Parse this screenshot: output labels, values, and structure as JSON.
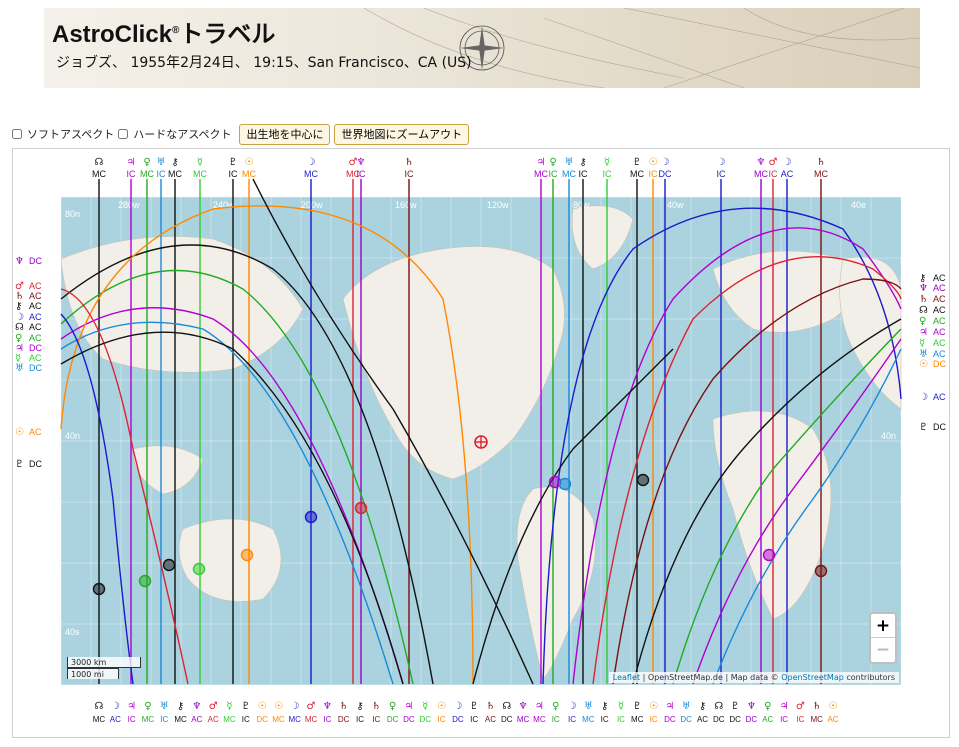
{
  "header": {
    "title": "AstroClick",
    "title_suffix": "トラベル",
    "registered": "®",
    "subtitle": "ジョブズ、 1955年2月24日、 19:15、San Francisco、CA (US)"
  },
  "toolbar": {
    "soft_aspect_label": "ソフトアスペクト",
    "hard_aspect_label": "ハードなアスペクト",
    "center_birthplace_button": "出生地を中心に",
    "zoom_out_world_button": "世界地図にズームアウト"
  },
  "map": {
    "longitude_labels": [
      "280w",
      "240w",
      "200w",
      "160w",
      "120w",
      "80w",
      "40w",
      "40e"
    ],
    "latitude_labels": [
      "80n",
      "40n",
      "40s",
      "40n",
      "40s"
    ],
    "scale": {
      "km": "3000 km",
      "mi": "1000 mi"
    },
    "zoom_in": "+",
    "zoom_out": "−",
    "attribution": {
      "leaflet": "Leaflet",
      "sep": " | OpenStreetMap.de | Map data © ",
      "osm": "OpenStreetMap",
      "tail": " contributors"
    },
    "colors": {
      "ocean": "#aad3df",
      "land": "#f2efe9",
      "grid": "#ffffff"
    }
  },
  "planet_lines": {
    "top": [
      {
        "glyph": "☊",
        "angle": "MC",
        "color": "#111111"
      },
      {
        "glyph": "♃",
        "angle": "IC",
        "color": "#b000d0"
      },
      {
        "glyph": "♀",
        "angle": "MC",
        "color": "#22aa22"
      },
      {
        "glyph": "♅",
        "angle": "IC",
        "color": "#1a8ad8"
      },
      {
        "glyph": "⚷",
        "angle": "MC",
        "color": "#111111"
      },
      {
        "glyph": "☿",
        "angle": "MC",
        "color": "#33cc33"
      },
      {
        "glyph": "♇",
        "angle": "IC",
        "color": "#111111"
      },
      {
        "glyph": "☉",
        "angle": "MC",
        "color": "#ff8800"
      },
      {
        "glyph": "☽",
        "angle": "MC",
        "color": "#1a1acc"
      },
      {
        "glyph": "♂",
        "angle": "MC",
        "color": "#dd2233"
      },
      {
        "glyph": "♆",
        "angle": "IC",
        "color": "#9900cc"
      },
      {
        "glyph": "♄",
        "angle": "IC",
        "color": "#7a1010"
      },
      {
        "glyph": "♃",
        "angle": "MC",
        "color": "#b000d0"
      },
      {
        "glyph": "♀",
        "angle": "IC",
        "color": "#22aa22"
      },
      {
        "glyph": "♅",
        "angle": "MC",
        "color": "#1a8ad8"
      },
      {
        "glyph": "⚷",
        "angle": "IC",
        "color": "#111111"
      },
      {
        "glyph": "☿",
        "angle": "IC",
        "color": "#33cc33"
      },
      {
        "glyph": "♇",
        "angle": "MC",
        "color": "#111111"
      },
      {
        "glyph": "☉",
        "angle": "IC",
        "color": "#ff8800"
      },
      {
        "glyph": "☽",
        "angle": "DC",
        "color": "#1a1acc"
      },
      {
        "glyph": "☽",
        "angle": "IC",
        "color": "#1a1acc"
      },
      {
        "glyph": "♆",
        "angle": "MC",
        "color": "#9900cc"
      },
      {
        "glyph": "♂",
        "angle": "IC",
        "color": "#dd2233"
      },
      {
        "glyph": "☽",
        "angle": "AC",
        "color": "#1a1acc"
      },
      {
        "glyph": "♄",
        "angle": "MC",
        "color": "#7a1010"
      }
    ],
    "left": [
      {
        "glyph": "♆",
        "angle": "DC",
        "color": "#9900cc"
      },
      {
        "glyph": "♂",
        "angle": "AC",
        "color": "#dd2233"
      },
      {
        "glyph": "♄",
        "angle": "AC",
        "color": "#7a1010"
      },
      {
        "glyph": "⚷",
        "angle": "AC",
        "color": "#111111"
      },
      {
        "glyph": "☽",
        "angle": "AC",
        "color": "#1a1acc"
      },
      {
        "glyph": "☊",
        "angle": "AC",
        "color": "#111111"
      },
      {
        "glyph": "♀",
        "angle": "AC",
        "color": "#22aa22"
      },
      {
        "glyph": "♃",
        "angle": "DC",
        "color": "#b000d0"
      },
      {
        "glyph": "☿",
        "angle": "AC",
        "color": "#33cc33"
      },
      {
        "glyph": "♅",
        "angle": "DC",
        "color": "#1a8ad8"
      },
      {
        "glyph": "☉",
        "angle": "AC",
        "color": "#ff8800"
      },
      {
        "glyph": "♇",
        "angle": "DC",
        "color": "#111111"
      }
    ],
    "right": [
      {
        "glyph": "⚷",
        "angle": "AC",
        "color": "#111111"
      },
      {
        "glyph": "♆",
        "angle": "AC",
        "color": "#9900cc"
      },
      {
        "glyph": "♄",
        "angle": "AC",
        "color": "#7a1010"
      },
      {
        "glyph": "☊",
        "angle": "AC",
        "color": "#111111"
      },
      {
        "glyph": "♀",
        "angle": "AC",
        "color": "#22aa22"
      },
      {
        "glyph": "♃",
        "angle": "AC",
        "color": "#b000d0"
      },
      {
        "glyph": "☿",
        "angle": "AC",
        "color": "#33cc33"
      },
      {
        "glyph": "♅",
        "angle": "AC",
        "color": "#1a8ad8"
      },
      {
        "glyph": "☉",
        "angle": "DC",
        "color": "#ff8800"
      },
      {
        "glyph": "☽",
        "angle": "AC",
        "color": "#1a1acc"
      },
      {
        "glyph": "♇",
        "angle": "DC",
        "color": "#111111"
      }
    ],
    "bottom": [
      {
        "glyph": "☊",
        "angle": "MC",
        "color": "#111111"
      },
      {
        "glyph": "☽",
        "angle": "AC",
        "color": "#1a1acc"
      },
      {
        "glyph": "♃",
        "angle": "IC",
        "color": "#b000d0"
      },
      {
        "glyph": "♀",
        "angle": "MC",
        "color": "#22aa22"
      },
      {
        "glyph": "♅",
        "angle": "IC",
        "color": "#1a8ad8"
      },
      {
        "glyph": "⚷",
        "angle": "MC",
        "color": "#111111"
      },
      {
        "glyph": "♆",
        "angle": "AC",
        "color": "#9900cc"
      },
      {
        "glyph": "♂",
        "angle": "AC",
        "color": "#dd2233"
      },
      {
        "glyph": "☿",
        "angle": "MC",
        "color": "#33cc33"
      },
      {
        "glyph": "♇",
        "angle": "IC",
        "color": "#111111"
      },
      {
        "glyph": "☉",
        "angle": "DC",
        "color": "#ff8800"
      },
      {
        "glyph": "☉",
        "angle": "MC",
        "color": "#ff8800"
      },
      {
        "glyph": "☽",
        "angle": "MC",
        "color": "#1a1acc"
      },
      {
        "glyph": "♂",
        "angle": "MC",
        "color": "#dd2233"
      },
      {
        "glyph": "♆",
        "angle": "IC",
        "color": "#9900cc"
      },
      {
        "glyph": "♄",
        "angle": "DC",
        "color": "#7a1010"
      },
      {
        "glyph": "⚷",
        "angle": "IC",
        "color": "#111111"
      },
      {
        "glyph": "♄",
        "angle": "IC",
        "color": "#7a1010"
      },
      {
        "glyph": "♀",
        "angle": "DC",
        "color": "#22aa22"
      },
      {
        "glyph": "♃",
        "angle": "DC",
        "color": "#b000d0"
      },
      {
        "glyph": "☿",
        "angle": "DC",
        "color": "#33cc33"
      },
      {
        "glyph": "☉",
        "angle": "IC",
        "color": "#ff8800"
      },
      {
        "glyph": "☽",
        "angle": "DC",
        "color": "#1a1acc"
      },
      {
        "glyph": "♇",
        "angle": "IC",
        "color": "#111111"
      },
      {
        "glyph": "♄",
        "angle": "AC",
        "color": "#7a1010"
      },
      {
        "glyph": "☊",
        "angle": "DC",
        "color": "#111111"
      },
      {
        "glyph": "♆",
        "angle": "MC",
        "color": "#9900cc"
      },
      {
        "glyph": "♃",
        "angle": "MC",
        "color": "#b000d0"
      },
      {
        "glyph": "♀",
        "angle": "IC",
        "color": "#22aa22"
      },
      {
        "glyph": "☽",
        "angle": "IC",
        "color": "#1a1acc"
      },
      {
        "glyph": "♅",
        "angle": "MC",
        "color": "#1a8ad8"
      },
      {
        "glyph": "⚷",
        "angle": "IC",
        "color": "#111111"
      },
      {
        "glyph": "☿",
        "angle": "IC",
        "color": "#33cc33"
      },
      {
        "glyph": "♇",
        "angle": "MC",
        "color": "#111111"
      },
      {
        "glyph": "☉",
        "angle": "IC",
        "color": "#ff8800"
      },
      {
        "glyph": "♃",
        "angle": "DC",
        "color": "#b000d0"
      },
      {
        "glyph": "♅",
        "angle": "DC",
        "color": "#1a8ad8"
      },
      {
        "glyph": "⚷",
        "angle": "AC",
        "color": "#111111"
      },
      {
        "glyph": "☊",
        "angle": "DC",
        "color": "#111111"
      },
      {
        "glyph": "♇",
        "angle": "DC",
        "color": "#111111"
      },
      {
        "glyph": "♆",
        "angle": "DC",
        "color": "#9900cc"
      },
      {
        "glyph": "♀",
        "angle": "AC",
        "color": "#22aa22"
      },
      {
        "glyph": "♃",
        "angle": "IC",
        "color": "#b000d0"
      },
      {
        "glyph": "♂",
        "angle": "IC",
        "color": "#dd2233"
      },
      {
        "glyph": "♄",
        "angle": "MC",
        "color": "#7a1010"
      },
      {
        "glyph": "☉",
        "angle": "AC",
        "color": "#ff8800"
      }
    ]
  }
}
